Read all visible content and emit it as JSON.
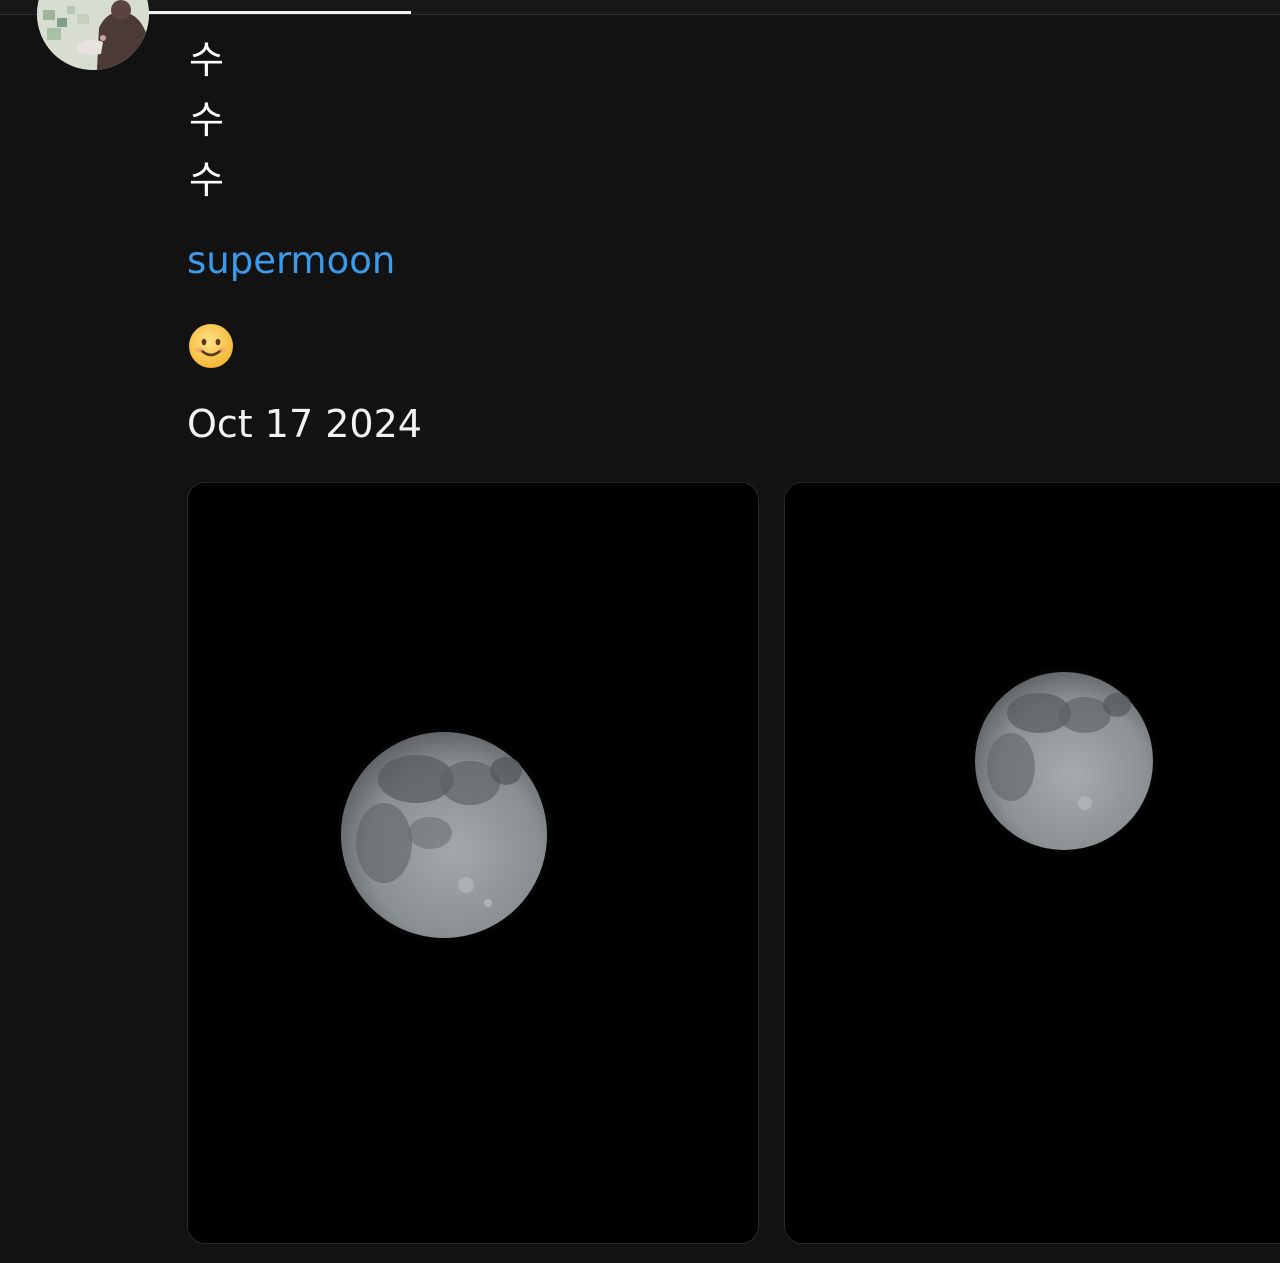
{
  "post": {
    "text_lines": [
      "수",
      "수",
      "수"
    ],
    "hashtag": "supermoon",
    "emoji": "🙂",
    "date": "Oct 17 2024"
  },
  "media": {
    "progress_fraction": 0.3,
    "images": [
      {
        "subject": "full moon"
      },
      {
        "subject": "full moon"
      }
    ]
  },
  "colors": {
    "background": "#121212",
    "hashtag": "#3d9ae8",
    "text": "#ffffff"
  }
}
